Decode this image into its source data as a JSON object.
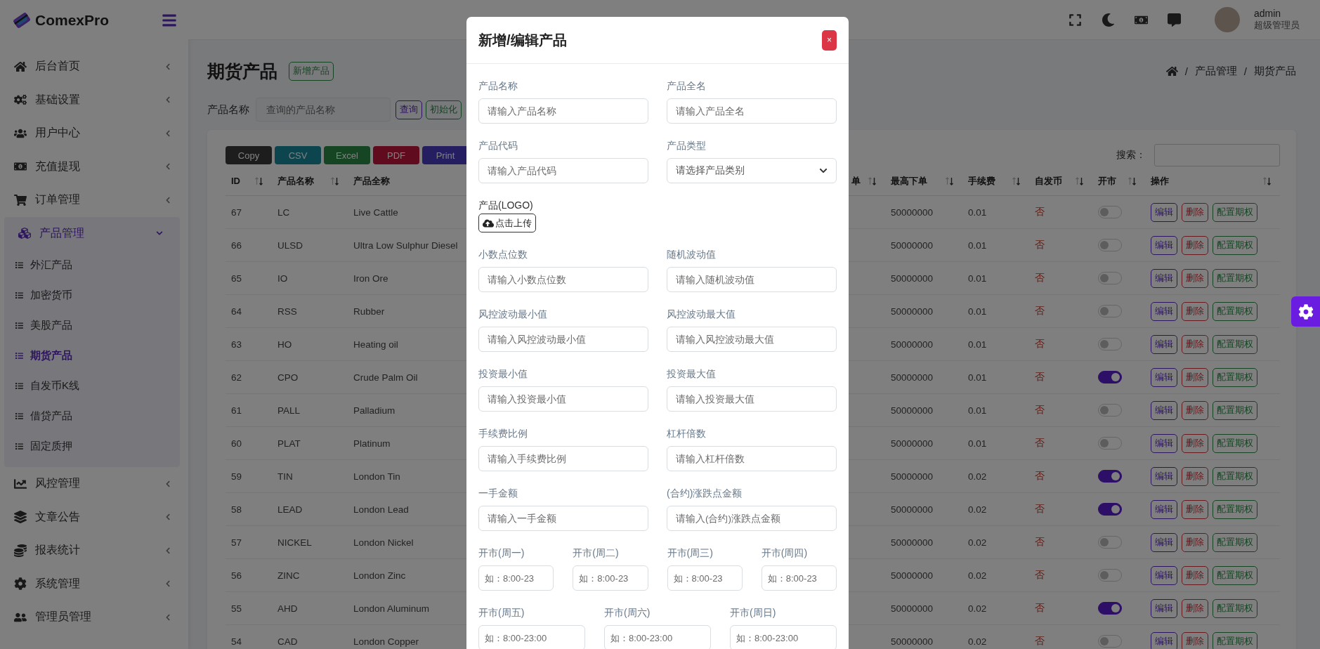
{
  "sidebar": {
    "logo": "ComexPro",
    "items": [
      {
        "label": "后台首页",
        "selected": false,
        "expanded": false
      },
      {
        "label": "基础设置",
        "selected": false,
        "expanded": false
      },
      {
        "label": "用户中心",
        "selected": false,
        "expanded": false
      },
      {
        "label": "充值提现",
        "selected": false,
        "expanded": false
      },
      {
        "label": "订单管理",
        "selected": false,
        "expanded": false
      },
      {
        "label": "产品管理",
        "selected": true,
        "expanded": true,
        "children": [
          {
            "label": "外汇产品",
            "selected": false
          },
          {
            "label": "加密货币",
            "selected": false
          },
          {
            "label": "美股产品",
            "selected": false
          },
          {
            "label": "期货产品",
            "selected": true
          },
          {
            "label": "自发币K线",
            "selected": false
          },
          {
            "label": "借贷产品",
            "selected": false
          },
          {
            "label": "固定质押",
            "selected": false
          }
        ]
      },
      {
        "label": "风控管理",
        "selected": false,
        "expanded": false
      },
      {
        "label": "文章公告",
        "selected": false,
        "expanded": false
      },
      {
        "label": "报表统计",
        "selected": false,
        "expanded": false
      },
      {
        "label": "系统管理",
        "selected": false,
        "expanded": false
      },
      {
        "label": "管理员管理",
        "selected": false,
        "expanded": false
      }
    ]
  },
  "topbar": {
    "user": "admin",
    "role": "超级管理员"
  },
  "page": {
    "title": "期货产品",
    "add_button": "新增产品",
    "breadcrumb": {
      "separator": "/",
      "items": [
        "产品管理",
        "期货产品"
      ]
    }
  },
  "filter": {
    "label": "产品名称",
    "placeholder": "查询的产品名称",
    "buttons": [
      "查询",
      "初始化"
    ]
  },
  "table": {
    "export_buttons": [
      "Copy",
      "CSV",
      "Excel",
      "PDF",
      "Print"
    ],
    "search_label": "搜索：",
    "columns": [
      "ID",
      "产品名称",
      "产品全称",
      "单",
      "最高下单",
      "手续费",
      "自发币",
      "开市",
      "操作"
    ],
    "rows": [
      {
        "id": "67",
        "code": "LC",
        "name": "Live Cattle",
        "max_order": "50000000",
        "fee": "0.01",
        "self_issued": "否",
        "open": false,
        "actions": [
          "编辑",
          "删除",
          "配置期权"
        ]
      },
      {
        "id": "66",
        "code": "ULSD",
        "name": "Ultra Low Sulphur Diesel",
        "max_order": "50000000",
        "fee": "0.01",
        "self_issued": "否",
        "open": false,
        "actions": [
          "编辑",
          "删除",
          "配置期权"
        ]
      },
      {
        "id": "65",
        "code": "IO",
        "name": "Iron Ore",
        "max_order": "50000000",
        "fee": "0.01",
        "self_issued": "否",
        "open": false,
        "actions": [
          "编辑",
          "删除",
          "配置期权"
        ]
      },
      {
        "id": "64",
        "code": "RSS",
        "name": "Rubber",
        "max_order": "50000000",
        "fee": "0.01",
        "self_issued": "否",
        "open": false,
        "actions": [
          "编辑",
          "删除",
          "配置期权"
        ]
      },
      {
        "id": "63",
        "code": "HO",
        "name": "Heating oil",
        "max_order": "50000000",
        "fee": "0.01",
        "self_issued": "否",
        "open": false,
        "actions": [
          "编辑",
          "删除",
          "配置期权"
        ]
      },
      {
        "id": "62",
        "code": "CPO",
        "name": "Crude Palm Oil",
        "max_order": "50000000",
        "fee": "0.01",
        "self_issued": "否",
        "open": true,
        "actions": [
          "编辑",
          "删除",
          "配置期权"
        ]
      },
      {
        "id": "61",
        "code": "PALL",
        "name": "Palladium",
        "max_order": "50000000",
        "fee": "0.01",
        "self_issued": "否",
        "open": false,
        "actions": [
          "编辑",
          "删除",
          "配置期权"
        ]
      },
      {
        "id": "60",
        "code": "PLAT",
        "name": "Platinum",
        "max_order": "50000000",
        "fee": "0.01",
        "self_issued": "否",
        "open": false,
        "actions": [
          "编辑",
          "删除",
          "配置期权"
        ]
      },
      {
        "id": "59",
        "code": "TIN",
        "name": "London Tin",
        "max_order": "50000000",
        "fee": "0.02",
        "self_issued": "否",
        "open": true,
        "actions": [
          "编辑",
          "删除",
          "配置期权"
        ]
      },
      {
        "id": "58",
        "code": "LEAD",
        "name": "London Lead",
        "max_order": "50000000",
        "fee": "0.02",
        "self_issued": "否",
        "open": true,
        "actions": [
          "编辑",
          "删除",
          "配置期权"
        ]
      },
      {
        "id": "57",
        "code": "NICKEL",
        "name": "London Nickel",
        "max_order": "50000000",
        "fee": "0.02",
        "self_issued": "否",
        "open": false,
        "actions": [
          "编辑",
          "删除",
          "配置期权"
        ]
      },
      {
        "id": "56",
        "code": "ZINC",
        "name": "London Zinc",
        "max_order": "50000000",
        "fee": "0.02",
        "self_issued": "否",
        "open": false,
        "actions": [
          "编辑",
          "删除",
          "配置期权"
        ]
      },
      {
        "id": "55",
        "code": "AHD",
        "name": "London Aluminum",
        "max_order": "50000000",
        "fee": "0.02",
        "self_issued": "否",
        "open": true,
        "actions": [
          "编辑",
          "删除",
          "配置期权"
        ]
      },
      {
        "id": "54",
        "code": "CAD",
        "name": "London Copper",
        "max_order": "50000000",
        "fee": "0.02",
        "self_issued": "否",
        "open": false,
        "actions": [
          "编辑",
          "删除",
          "配置期权"
        ]
      }
    ]
  },
  "modal": {
    "title": "新增/编辑产品",
    "close": "×",
    "fields": [
      {
        "kind": "input",
        "label": "产品名称",
        "placeholder": "请输入产品名称"
      },
      {
        "kind": "input",
        "label": "产品全名",
        "placeholder": "请输入产品全名"
      },
      {
        "kind": "input",
        "label": "产品代码",
        "placeholder": "请输入产品代码"
      },
      {
        "kind": "select",
        "label": "产品类型",
        "placeholder": "请选择产品类别"
      },
      {
        "kind": "upload",
        "label": "产品(LOGO)",
        "button": "点击上传"
      },
      {
        "kind": "input",
        "label": "小数点位数",
        "placeholder": "请输入小数点位数"
      },
      {
        "kind": "input",
        "label": "随机波动值",
        "placeholder": "请输入随机波动值"
      },
      {
        "kind": "input",
        "label": "风控波动最小值",
        "placeholder": "请输入风控波动最小值"
      },
      {
        "kind": "input",
        "label": "风控波动最大值",
        "placeholder": "请输入风控波动最大值"
      },
      {
        "kind": "input",
        "label": "投资最小值",
        "placeholder": "请输入投资最小值"
      },
      {
        "kind": "input",
        "label": "投资最大值",
        "placeholder": "请输入投资最大值"
      },
      {
        "kind": "input",
        "label": "手续费比例",
        "placeholder": "请输入手续费比例"
      },
      {
        "kind": "input",
        "label": "杠杆倍数",
        "placeholder": "请输入杠杆倍数"
      },
      {
        "kind": "input",
        "label": "一手金额",
        "placeholder": "请输入一手金额"
      },
      {
        "kind": "input",
        "label": "(合约)涨跌点金额",
        "placeholder": "请输入(合约)涨跌点金额"
      }
    ],
    "hours_rows": [
      [
        {
          "label": "开市(周一)",
          "placeholder": "如：8:00-23"
        },
        {
          "label": "开市(周二)",
          "placeholder": "如：8:00-23"
        },
        {
          "label": "开市(周三)",
          "placeholder": "如：8:00-23"
        },
        {
          "label": "开市(周四)",
          "placeholder": "如：8:00-23"
        }
      ],
      [
        {
          "label": "开市(周五)",
          "placeholder": "如：8:00-23:00"
        },
        {
          "label": "开市(周六)",
          "placeholder": "如：8:00-23:00"
        },
        {
          "label": "开市(周日)",
          "placeholder": "如：8:00-23:00"
        }
      ]
    ]
  }
}
